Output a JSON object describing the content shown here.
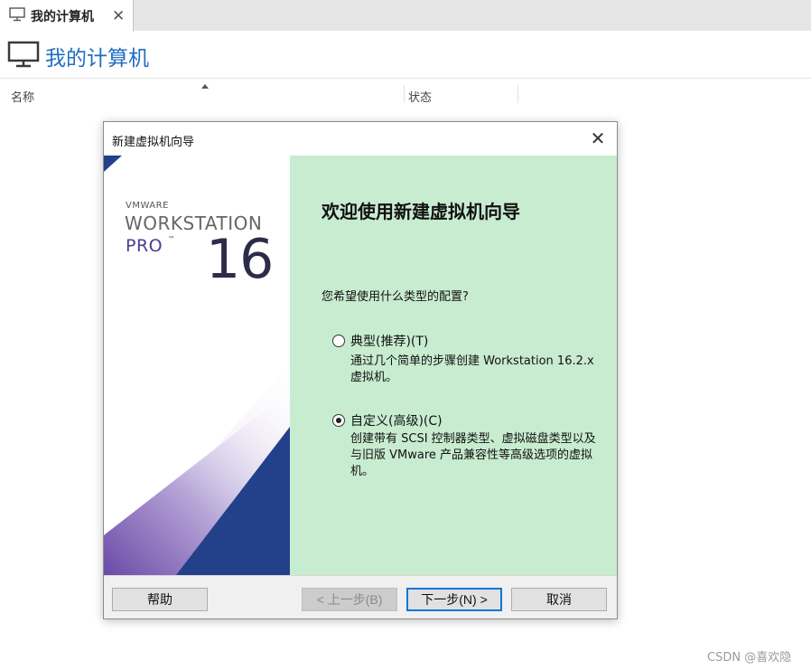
{
  "tab": {
    "label": "我的计算机",
    "close": "✕"
  },
  "page": {
    "title": "我的计算机"
  },
  "columns": [
    {
      "label": "名称"
    },
    {
      "label": "状态"
    }
  ],
  "dialog": {
    "title": "新建虚拟机向导",
    "close": "✕",
    "banner": {
      "brand": "VMWARE",
      "product": "WORKSTATION",
      "edition": "PRO",
      "tm": "™",
      "version": "16"
    },
    "heading": "欢迎使用新建虚拟机向导",
    "question": "您希望使用什么类型的配置?",
    "options": [
      {
        "label": "典型(推荐)(T)",
        "selected": false,
        "description": "通过几个简单的步骤创建 Workstation 16.2.x 虚拟机。"
      },
      {
        "label": "自定义(高级)(C)",
        "selected": true,
        "description": "创建带有 SCSI 控制器类型、虚拟磁盘类型以及与旧版 VMware 产品兼容性等高级选项的虚拟机。"
      }
    ],
    "buttons": {
      "help": "帮助",
      "back": "< 上一步(B)",
      "next": "下一步(N) >",
      "cancel": "取消"
    }
  },
  "watermark": "CSDN @喜欢隐",
  "colors": {
    "accent": "#1f6fc0",
    "content_bg": "#c8ecd0",
    "banner_purple": "#5a3f96",
    "banner_navy": "#22418a"
  }
}
